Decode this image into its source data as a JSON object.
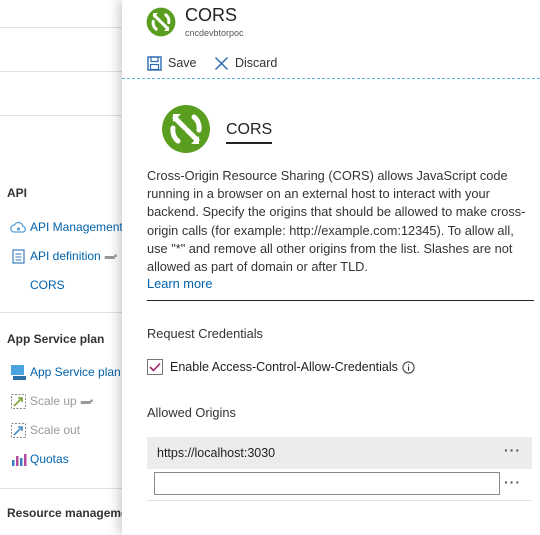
{
  "sidebar": {
    "sections": {
      "api": "API",
      "app_service_plan": "App Service plan",
      "resource_management": "Resource management"
    },
    "items": {
      "api_management": "API Management",
      "api_definition": "API definition",
      "cors": "CORS",
      "app_service_plan": "App Service plan",
      "scale_up": "Scale up",
      "scale_out": "Scale out",
      "quotas": "Quotas"
    }
  },
  "blade": {
    "title": "CORS",
    "subtitle": "cncdevbtorpoc",
    "toolbar": {
      "save_label": "Save",
      "discard_label": "Discard"
    },
    "heading": "CORS",
    "description": "Cross-Origin Resource Sharing (CORS) allows JavaScript code running in a browser on an external host to interact with your backend. Specify the origins that should be allowed to make cross-origin calls (for example: http://example.com:12345). To allow all, use \"*\" and remove all other origins from the list. Slashes are not allowed as part of domain or after TLD.",
    "learn_more": "Learn more",
    "request_credentials": {
      "label": "Request Credentials",
      "checkbox_label": "Enable Access-Control-Allow-Credentials",
      "checked": true
    },
    "allowed_origins": {
      "label": "Allowed Origins",
      "origins": [
        "https://localhost:3030"
      ],
      "new_origin_value": "",
      "more_glyph": "···"
    }
  },
  "colors": {
    "accent_green": "#5a9e1f",
    "link_blue": "#0062ad",
    "checkbox_check": "#a1246a",
    "origin_row_bg": "#ececec"
  },
  "icons": {
    "app_logo": "cors-logo-icon",
    "save": "save-icon",
    "discard": "close-icon",
    "info": "info-icon",
    "more": "more-icon"
  }
}
